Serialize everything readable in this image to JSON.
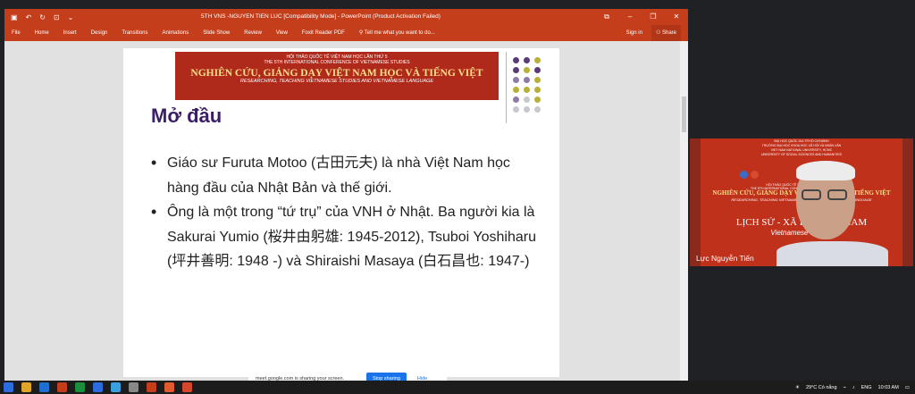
{
  "window": {
    "title": "5TH VNS -NGUYEN TIEN LUC [Compatibility Mode] - PowerPoint (Product Activation Failed)",
    "controls": [
      "⧉",
      "–",
      "❐",
      "✕"
    ]
  },
  "ribbon": {
    "tabs": [
      "File",
      "Home",
      "Insert",
      "Design",
      "Transitions",
      "Animations",
      "Slide Show",
      "Review",
      "View",
      "Foxit Reader PDF"
    ],
    "tell_me": "Tell me what you want to do...",
    "sign_in": "Sign in",
    "share": "Share"
  },
  "slide": {
    "banner": {
      "line1": "HỘI THẢO QUỐC TẾ VIỆT NAM HỌC LẦN THỨ 5",
      "line2": "THE 5TH INTERNATIONAL CONFERENCE OF VIETNAMESE STUDIES",
      "line3": "NGHIÊN CỨU, GIẢNG DẠY VIỆT NAM HỌC VÀ TIẾNG VIỆT",
      "line4": "RESEARCHING, TEACHING VIETNAMESE STUDIES AND VIETNAMESE LANGUAGE"
    },
    "title": "Mở đầu",
    "bullets": [
      "Giáo sư Furuta Motoo (古田元夫) là nhà Việt Nam học hàng đầu của Nhật Bản và thế giới.",
      "Ông là một trong “tứ trụ” của VNH ở Nhật. Ba người kia là Sakurai Yumio (桜井由躬雄: 1945-2012), Tsuboi Yoshiharu (坪井善明: 1948 -) và Shiraishi Masaya (白石昌也: 1947-)"
    ],
    "dot_colors": [
      "#5a3a78",
      "#b9b03a",
      "#8e7aa8",
      "#c8c8d0"
    ]
  },
  "video": {
    "banner_lines": [
      "ĐẠI HỌC QUỐC GIA TP.HỒ CHÍ MINH",
      "TRƯỜNG ĐẠI HỌC KHOA HỌC XÃ HỘI VÀ NHÂN VĂN",
      "VIET NAM NATIONAL UNIVERSITY, HCMC",
      "UNIVERSITY OF SOCIAL SCIENCES AND HUMANITIES",
      "HỘI THẢO QUỐC TẾ VIỆT NAM HỌC LẦN THỨ 5",
      "THE 5TH INTERNATIONAL CONFERENCE OF VIETNAMESE STUDIES"
    ],
    "big": "NGHIÊN CỨU, GIẢNG DẠY VIỆT NAM HỌC VÀ TIẾNG VIỆT",
    "sub": "RESEARCHING, TEACHING VIETNAMESE STUDIES AND VIETNAMESE LANGUAGE",
    "session": "LỊCH SỬ - XÃ HỘI VIỆT NAM",
    "session_en": "Vietnamese History",
    "participant": "Lực Nguyễn Tiến"
  },
  "sharebar": {
    "message": "meet.google.com is sharing your screen.",
    "stop": "Stop sharing",
    "hide": "Hide"
  },
  "taskbar": {
    "weather": "29°C Có nắng",
    "lang": "ENG",
    "time": "10:03 AM",
    "icon_colors": [
      "#2d6cdf",
      "#e0a42b",
      "#1f6fd1",
      "#c43e1c",
      "#1a8f3d",
      "#2d6cdf",
      "#3ba0e0",
      "#888888",
      "#c43e1c",
      "#e05a2b",
      "#d4472c"
    ]
  }
}
